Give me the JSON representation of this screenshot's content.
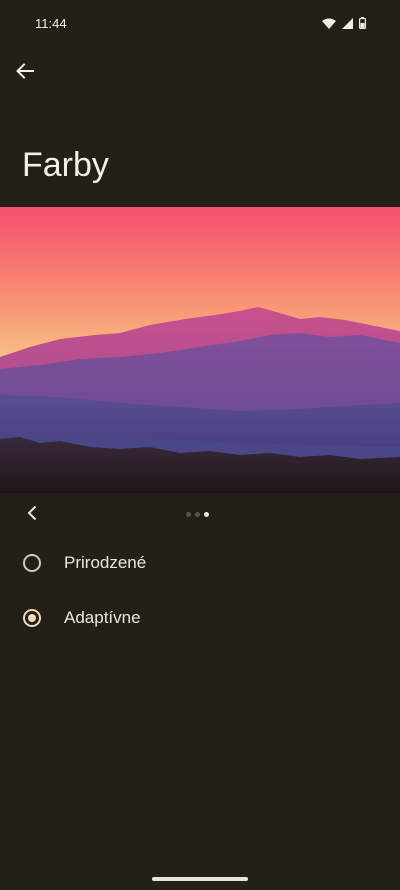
{
  "status_bar": {
    "time": "11:44",
    "icons": [
      "wifi-icon",
      "cellular-signal-icon",
      "battery-icon"
    ]
  },
  "header": {
    "back_icon": "arrow-back-icon",
    "title": "Farby"
  },
  "preview": {
    "image": "sunset-mountains-wallpaper",
    "page_count": 3,
    "current_page": 3
  },
  "options": [
    {
      "label": "Prirodzené",
      "selected": false
    },
    {
      "label": "Adaptívne",
      "selected": true
    }
  ],
  "colors": {
    "background": "#23201a",
    "accent": "#f6d9b3"
  }
}
